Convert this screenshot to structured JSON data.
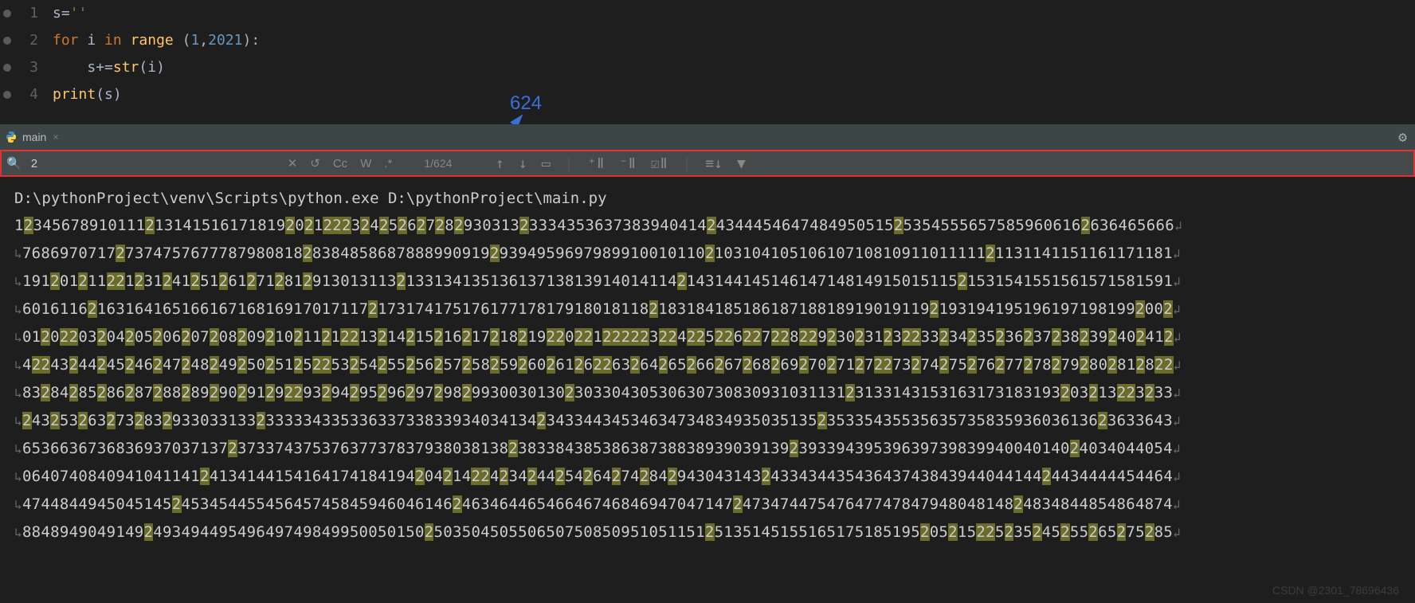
{
  "code": {
    "l1_num": "1",
    "l1_a": "s",
    "l1_b": "=",
    "l1_c": "''",
    "l2_num": "2",
    "l2_a": "for ",
    "l2_b": "i ",
    "l2_c": "in ",
    "l2_d": "range ",
    "l2_e": "(",
    "l2_f": "1",
    "l2_g": ",",
    "l2_h": "2021",
    "l2_i": "):",
    "l3_num": "3",
    "l3_a": "    s",
    "l3_b": "+=",
    "l3_c": "str",
    "l3_d": "(i)",
    "l4_num": "4",
    "l4_a": "print",
    "l4_b": "(s)"
  },
  "tab": {
    "label": "main",
    "close": "×"
  },
  "settings_icon": "⚙",
  "find": {
    "query": "2",
    "count": "1/624",
    "cc": "Cc",
    "w": "W",
    "regex": ".*",
    "clear": "✕",
    "rev": "↺"
  },
  "tools": {
    "up": "↑",
    "down": "↓",
    "new": "▭",
    "ins1": "⁺ǁ",
    "ins2": "⁻ǁ",
    "sel": "☑ǁ",
    "sort": "≡↓",
    "filter": "▼"
  },
  "annotation": "624",
  "console": {
    "cmd": "D:\\pythonProject\\venv\\Scripts\\python.exe D:\\pythonProject\\main.py",
    "lines": [
      "1234567891011121314151617181920212223242526272829303132333435363738394041424344454647484950515253545556575859606162636465666",
      "768697071727374757677787980818283848586878889909192939495969798991001011021031041051061071081091101111121131141151161171181",
      "191201211221231241251261271281291301311321331341351361371381391401411421431441451461471481491501511521531541551561571581591",
      "601611621631641651661671681691701711721731741751761771781791801811821831841851861871881891901911921931941951961971981992002",
      "012022032042052062072082092102112122132142152162172182192202212222232242252262272282292302312322332342352362372382392402412",
      "422432442452462472482492502512522532542552562572582592602612622632642652662672682692702712722732742752762772782792802812822",
      "832842852862872882892902912922932942952962972982993003013023033043053063073083093103113123133143153163173183193203213223233",
      "243253263273283293303313323333343353363373383393403413423433443453463473483493503513523533543553563573583593603613623633643",
      "653663673683693703713723733743753763773783793803813823833843853863873883893903913923933943953963973983994004014024034044054",
      "064074084094104114124134144154164174184194204214224234244254264274284294304314324334344354364374384394404414424434444454464",
      "474484494504514524534544554564574584594604614624634644654664674684694704714724734744754764774784794804814824834844854864874",
      "884894904914924934944954964974984995005015025035045055065075085095105115125135145155165175185195205215225235245255265275285"
    ]
  },
  "watermark": "CSDN @2301_78696436"
}
